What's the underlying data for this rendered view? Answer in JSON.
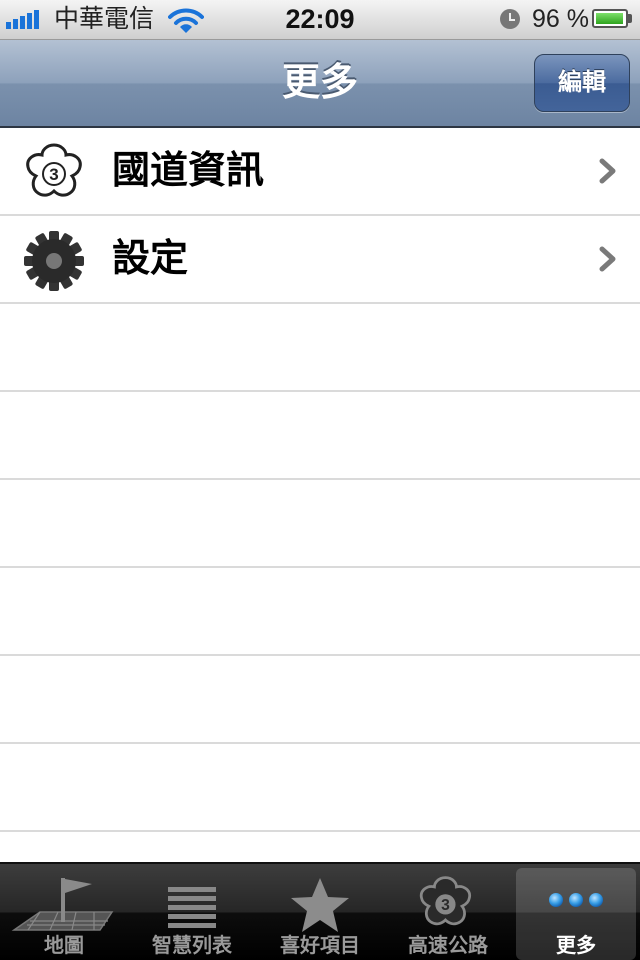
{
  "status_bar": {
    "carrier": "中華電信",
    "time": "22:09",
    "battery_percent": "96 %",
    "battery_level": 0.96,
    "icons": [
      "signal-icon",
      "wifi-icon",
      "alarm-icon",
      "battery-icon"
    ]
  },
  "nav": {
    "title": "更多",
    "edit_label": "編輯"
  },
  "list": {
    "items": [
      {
        "label": "國道資訊",
        "icon": "highway-3-shield-icon"
      },
      {
        "label": "設定",
        "icon": "gear-icon"
      }
    ]
  },
  "tabbar": {
    "tabs": [
      {
        "label": "地圖",
        "icon": "map-flag-icon",
        "selected": false
      },
      {
        "label": "智慧列表",
        "icon": "list-icon",
        "selected": false
      },
      {
        "label": "喜好項目",
        "icon": "star-icon",
        "selected": false
      },
      {
        "label": "高速公路",
        "icon": "highway-3-shield-icon",
        "selected": false
      },
      {
        "label": "更多",
        "icon": "more-dots-icon",
        "selected": true
      }
    ]
  },
  "colors": {
    "nav_bar": "#8da1bb",
    "edit_button": "#4b6b9f",
    "tab_bar": "#1a1a1a",
    "selected_dots": "#3aa0e8"
  }
}
